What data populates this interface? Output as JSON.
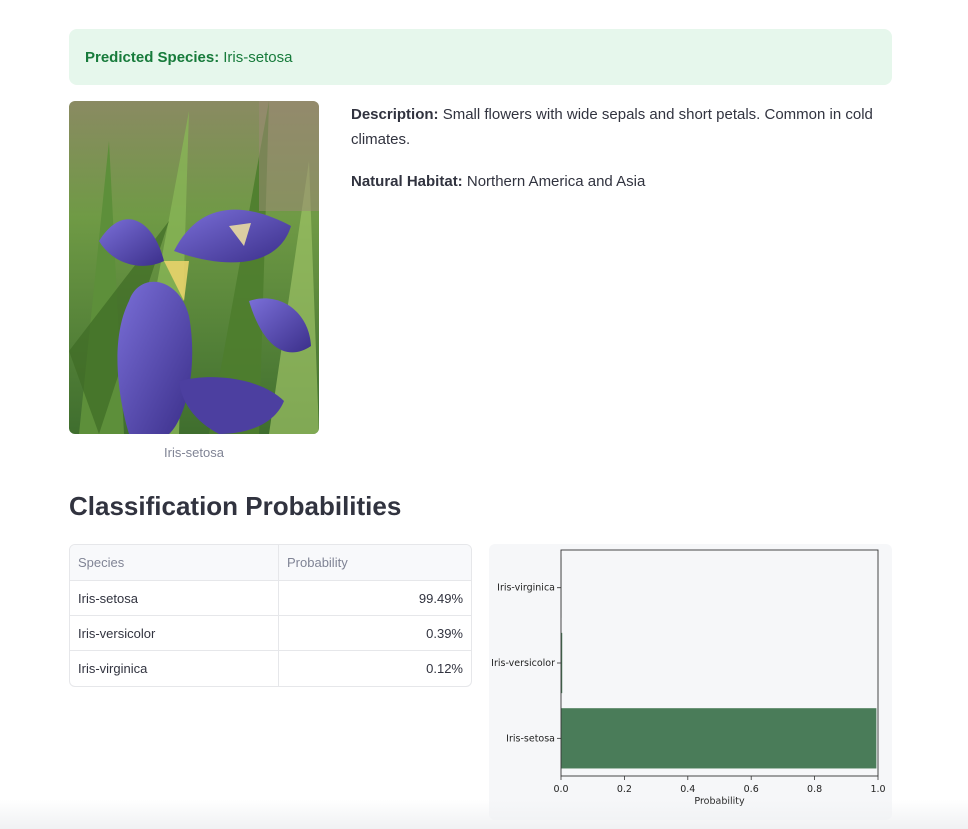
{
  "result": {
    "label": "Predicted Species:",
    "value": "Iris-setosa",
    "color": "#177b3b",
    "background": "#e6f7ec"
  },
  "image": {
    "caption": "Iris-setosa"
  },
  "details": {
    "description_label": "Description:",
    "description_text": "Small flowers with wide sepals and short petals. Common in cold climates.",
    "habitat_label": "Natural Habitat:",
    "habitat_text": "Northern America and Asia"
  },
  "section": {
    "title": "Classification Probabilities"
  },
  "table": {
    "headers": [
      "Species",
      "Probability"
    ],
    "rows": [
      {
        "species": "Iris-setosa",
        "probability": "99.49%"
      },
      {
        "species": "Iris-versicolor",
        "probability": "0.39%"
      },
      {
        "species": "Iris-virginica",
        "probability": "0.12%"
      }
    ]
  },
  "chart_data": {
    "type": "bar",
    "orientation": "horizontal",
    "categories": [
      "Iris-setosa",
      "Iris-versicolor",
      "Iris-virginica"
    ],
    "values": [
      0.9949,
      0.0039,
      0.0012
    ],
    "xlabel": "Probability",
    "ylabel": "",
    "xlim": [
      0,
      1
    ],
    "xticks": [
      "0.0",
      "0.2",
      "0.4",
      "0.6",
      "0.8",
      "1.0"
    ],
    "bar_color": "#4a7c59",
    "grid": false,
    "legend": "none"
  }
}
